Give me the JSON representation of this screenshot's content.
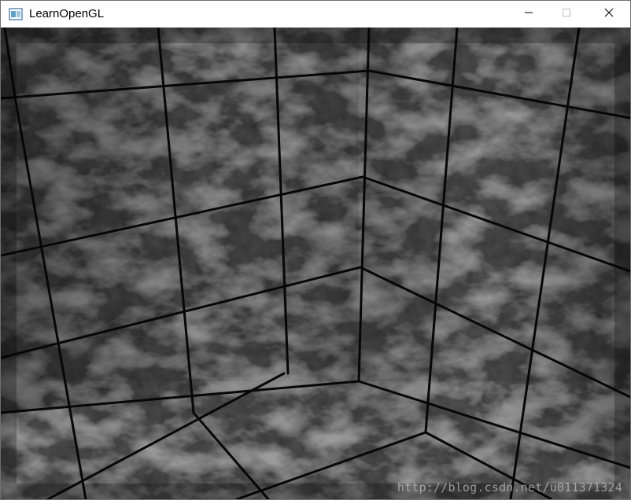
{
  "window": {
    "title": "LearnOpenGL"
  },
  "caption_buttons": {
    "minimize": "minimize-icon",
    "maximize": "maximize-icon",
    "close": "close-icon"
  },
  "viewport": {
    "scene": "tiled-marble-room-corner",
    "watermark": "http://blog.csdn.net/u011371324"
  },
  "colors": {
    "titlebar_bg": "#ffffff",
    "tile_base": "#2e2e2e",
    "grout": "#0a0a0a",
    "vein": "#9a9a9a"
  }
}
